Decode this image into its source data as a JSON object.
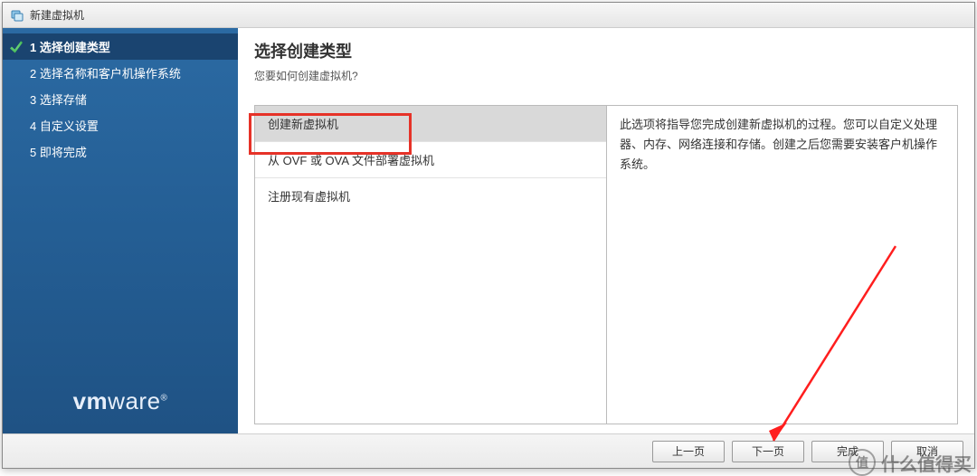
{
  "window": {
    "title": "新建虚拟机"
  },
  "sidebar": {
    "steps": [
      {
        "num": "1",
        "label": "选择创建类型",
        "active": true
      },
      {
        "num": "2",
        "label": "选择名称和客户机操作系统",
        "active": false
      },
      {
        "num": "3",
        "label": "选择存储",
        "active": false
      },
      {
        "num": "4",
        "label": "自定义设置",
        "active": false
      },
      {
        "num": "5",
        "label": "即将完成",
        "active": false
      }
    ],
    "brand_vm": "vm",
    "brand_ware": "ware",
    "brand_reg": "®"
  },
  "main": {
    "heading": "选择创建类型",
    "subtitle": "您要如何创建虚拟机?",
    "options": [
      {
        "label": "创建新虚拟机",
        "selected": true
      },
      {
        "label": "从 OVF 或 OVA 文件部署虚拟机",
        "selected": false
      },
      {
        "label": "注册现有虚拟机",
        "selected": false
      }
    ],
    "description": "此选项将指导您完成创建新虚拟机的过程。您可以自定义处理器、内存、网络连接和存储。创建之后您需要安装客户机操作系统。"
  },
  "footer": {
    "prev": "上一页",
    "next": "下一页",
    "finish": "完成",
    "cancel": "取消"
  },
  "watermark": {
    "badge": "值",
    "text": "什么值得买"
  }
}
